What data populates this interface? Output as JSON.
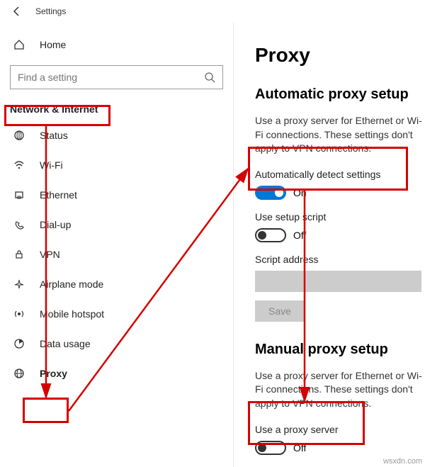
{
  "titlebar": {
    "title": "Settings"
  },
  "sidebar": {
    "home_label": "Home",
    "search_placeholder": "Find a setting",
    "category": "Network & Internet",
    "items": [
      {
        "label": "Status"
      },
      {
        "label": "Wi-Fi"
      },
      {
        "label": "Ethernet"
      },
      {
        "label": "Dial-up"
      },
      {
        "label": "VPN"
      },
      {
        "label": "Airplane mode"
      },
      {
        "label": "Mobile hotspot"
      },
      {
        "label": "Data usage"
      },
      {
        "label": "Proxy"
      }
    ]
  },
  "content": {
    "title": "Proxy",
    "auto_heading": "Automatic proxy setup",
    "auto_desc": "Use a proxy server for Ethernet or Wi-Fi connections. These settings don't apply to VPN connections.",
    "auto_detect_label": "Automatically detect settings",
    "auto_detect_state": "On",
    "script_label": "Use setup script",
    "script_state": "Off",
    "script_addr_label": "Script address",
    "save_label": "Save",
    "manual_heading": "Manual proxy setup",
    "manual_desc": "Use a proxy server for Ethernet or Wi-Fi connections. These settings don't apply to VPN connections.",
    "use_proxy_label": "Use a proxy server",
    "use_proxy_state": "Off"
  },
  "watermark": "wsxdn.com"
}
